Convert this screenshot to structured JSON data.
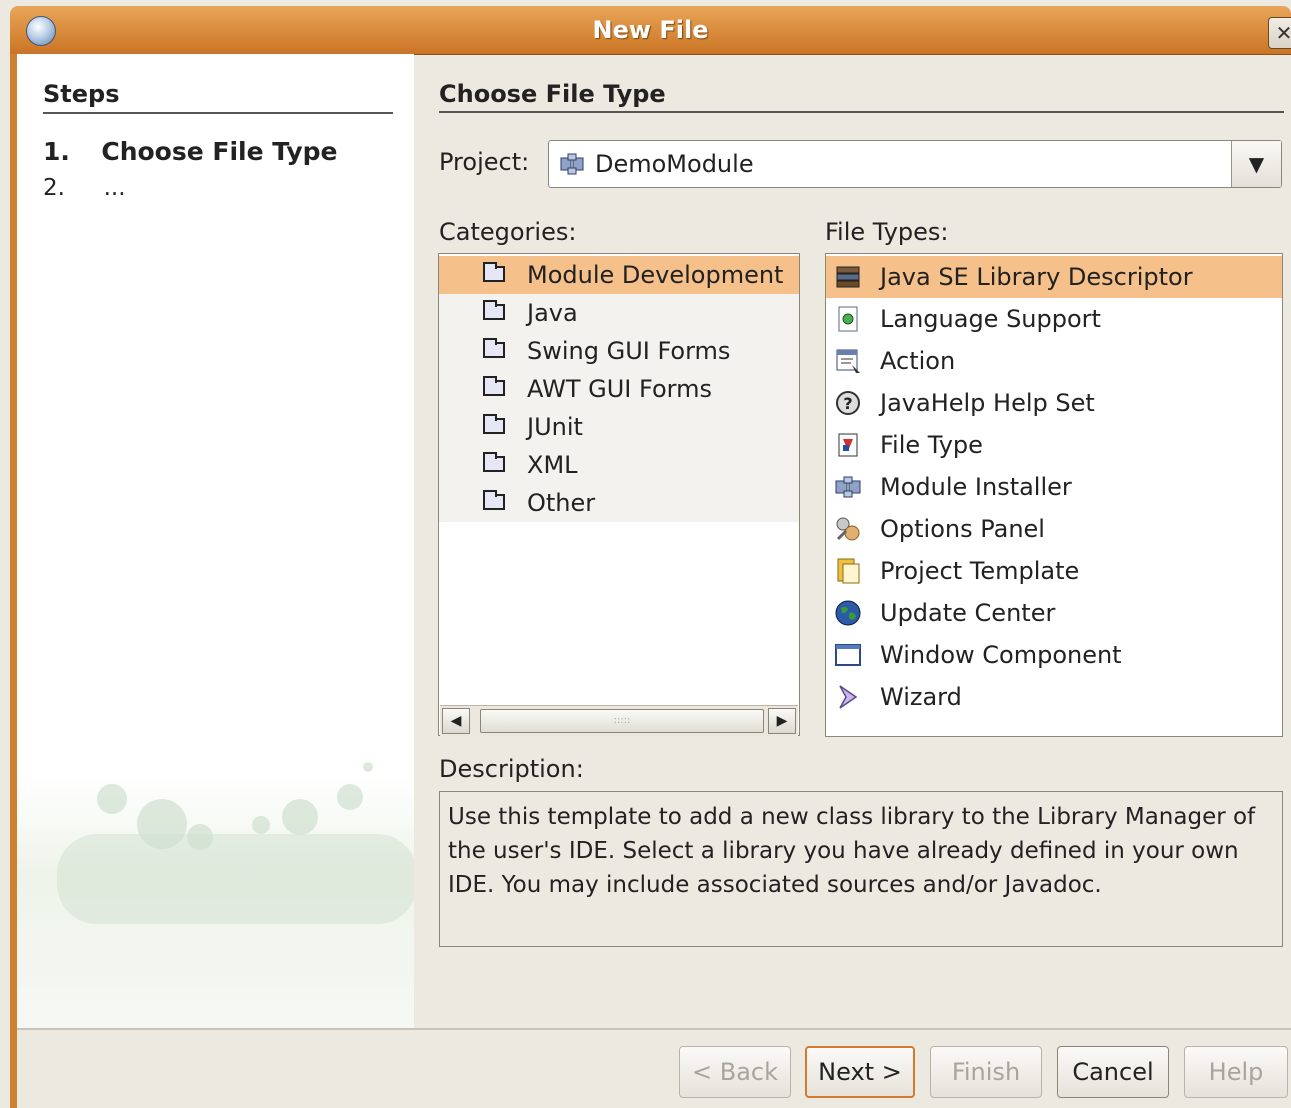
{
  "window": {
    "title": "New File",
    "close_label": "✕"
  },
  "steps": {
    "title": "Steps",
    "items": [
      {
        "num": "1.",
        "label": "Choose File Type"
      },
      {
        "num": "2.",
        "label": "..."
      }
    ]
  },
  "main": {
    "title": "Choose File Type",
    "project_label": "Project:",
    "project_value": "DemoModule",
    "categories_label": "Categories:",
    "file_types_label": "File Types:",
    "categories": [
      "Module Development",
      "Java",
      "Swing GUI Forms",
      "AWT GUI Forms",
      "JUnit",
      "XML",
      "Other"
    ],
    "selected_category": "Module Development",
    "file_types": [
      {
        "label": "Java SE Library Descriptor",
        "icon": "library-icon"
      },
      {
        "label": "Language Support",
        "icon": "language-icon"
      },
      {
        "label": "Action",
        "icon": "action-icon"
      },
      {
        "label": "JavaHelp Help Set",
        "icon": "help-icon"
      },
      {
        "label": "File Type",
        "icon": "filetype-icon"
      },
      {
        "label": "Module Installer",
        "icon": "module-icon"
      },
      {
        "label": "Options Panel",
        "icon": "options-icon"
      },
      {
        "label": "Project Template",
        "icon": "template-icon"
      },
      {
        "label": "Update Center",
        "icon": "globe-icon"
      },
      {
        "label": "Window Component",
        "icon": "window-icon"
      },
      {
        "label": "Wizard",
        "icon": "wizard-icon"
      }
    ],
    "selected_file_type": "Java SE Library Descriptor",
    "description_label": "Description:",
    "description": "Use this template to add a new class library to the Library Manager of the user's IDE. Select a library you have already defined in your own IDE. You may include associated sources and/or Javadoc."
  },
  "buttons": {
    "back": "< Back",
    "next": "Next >",
    "finish": "Finish",
    "cancel": "Cancel",
    "help": "Help"
  },
  "colors": {
    "titlebar": "#d98a3a",
    "selection": "#f5c08a",
    "default_button_border": "#d27a2d"
  }
}
